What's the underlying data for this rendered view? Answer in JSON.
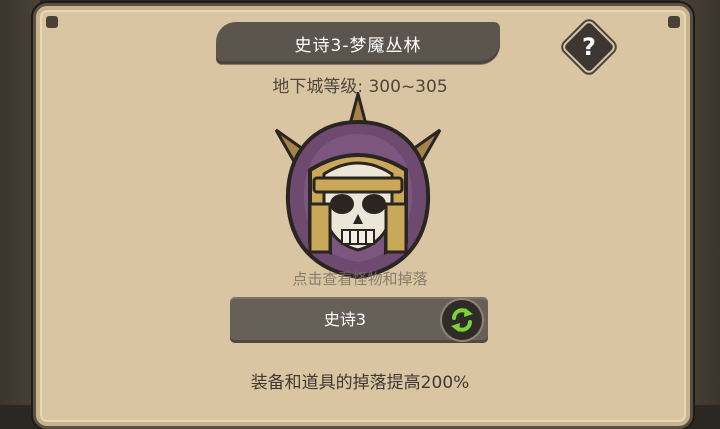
{
  "header": {
    "title": "史诗3-梦魇丛林",
    "help_icon": "question-mark"
  },
  "dungeon": {
    "level_text": "地下城等级: 300~305",
    "boss_icon": "armored-skull-helmet",
    "hint": "点击查看怪物和掉落"
  },
  "difficulty": {
    "label": "史诗3",
    "swap_icon": "swap-arrows",
    "swap_color": "#7bd23a"
  },
  "bonus": {
    "text": "装备和道具的掉落提高200%"
  }
}
